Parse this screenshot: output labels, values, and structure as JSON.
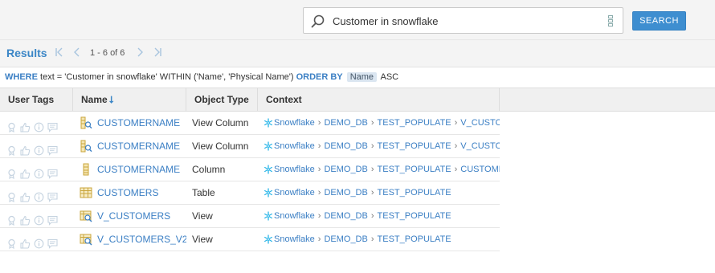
{
  "search": {
    "query": "Customer in snowflake",
    "button_label": "SEARCH"
  },
  "results": {
    "title": "Results",
    "page_range": "1 - 6 of 6"
  },
  "query_line": {
    "where_kw": "WHERE",
    "text_expr": "text = 'Customer in snowflake' WITHIN ('Name', 'Physical Name')",
    "order_kw": "ORDER BY",
    "order_field": "Name",
    "order_dir": "ASC"
  },
  "columns": {
    "tags": "User Tags",
    "name": "Name",
    "type": "Object Type",
    "context": "Context"
  },
  "colors": {
    "accent": "#3b86c6",
    "link": "#3b7fc4",
    "header_bg": "#f0f0f0",
    "icon_gray": "#c5d3e0"
  },
  "rows": [
    {
      "icon": "view-column-icon",
      "name": "CUSTOMERNAME",
      "type": "View Column",
      "context": [
        "Snowflake",
        "DEMO_DB",
        "TEST_POPULATE",
        "V_CUSTOM"
      ]
    },
    {
      "icon": "view-column-icon",
      "name": "CUSTOMERNAME",
      "type": "View Column",
      "context": [
        "Snowflake",
        "DEMO_DB",
        "TEST_POPULATE",
        "V_CUSTOM"
      ]
    },
    {
      "icon": "column-icon",
      "name": "CUSTOMERNAME",
      "type": "Column",
      "context": [
        "Snowflake",
        "DEMO_DB",
        "TEST_POPULATE",
        "CUSTOMER"
      ]
    },
    {
      "icon": "table-icon",
      "name": "CUSTOMERS",
      "type": "Table",
      "context": [
        "Snowflake",
        "DEMO_DB",
        "TEST_POPULATE"
      ]
    },
    {
      "icon": "view-icon",
      "name": "V_CUSTOMERS",
      "type": "View",
      "context": [
        "Snowflake",
        "DEMO_DB",
        "TEST_POPULATE"
      ]
    },
    {
      "icon": "view-icon",
      "name": "V_CUSTOMERS_V2",
      "type": "View",
      "context": [
        "Snowflake",
        "DEMO_DB",
        "TEST_POPULATE"
      ]
    }
  ]
}
